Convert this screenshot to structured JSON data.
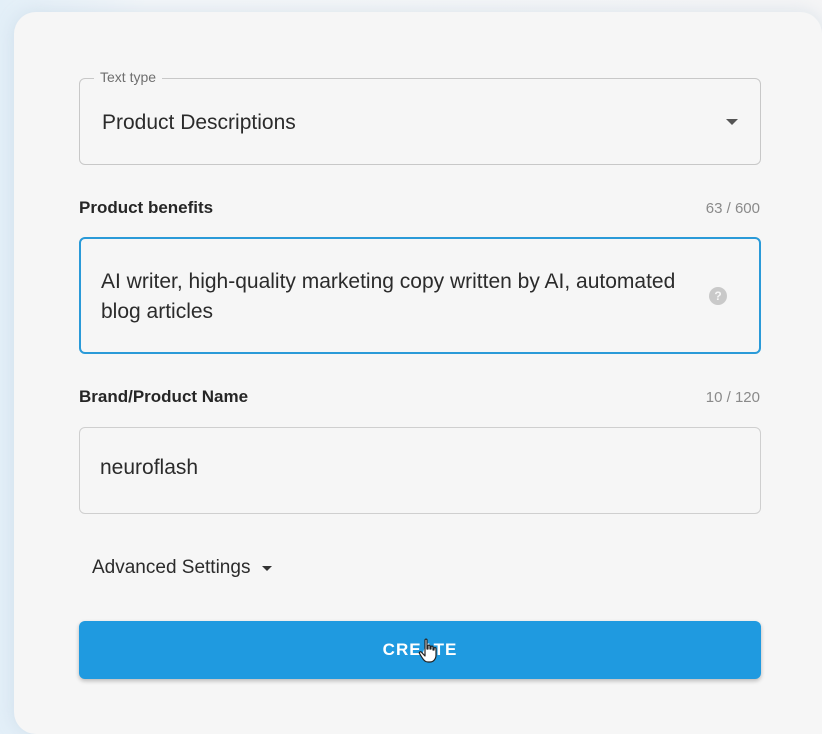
{
  "form": {
    "text_type": {
      "legend": "Text type",
      "value": "Product Descriptions"
    },
    "product_benefits": {
      "label": "Product benefits",
      "counter": "63 / 600",
      "value": "AI writer, high-quality marketing copy written by AI, automated blog articles",
      "help_glyph": "?"
    },
    "brand_name": {
      "label": "Brand/Product Name",
      "counter": "10 / 120",
      "value": "neuroflash"
    },
    "advanced_settings": {
      "label": "Advanced Settings"
    },
    "create_button": {
      "label": "CREATE"
    }
  },
  "icons": {
    "select_caret": "caret-down-icon",
    "help": "help-circle-icon",
    "advanced_caret": "caret-down-icon",
    "cursor": "hand-pointer-icon"
  },
  "colors": {
    "accent": "#1f9ae0",
    "focus_border": "#2a9ad8",
    "card_bg": "#f6f6f6"
  }
}
